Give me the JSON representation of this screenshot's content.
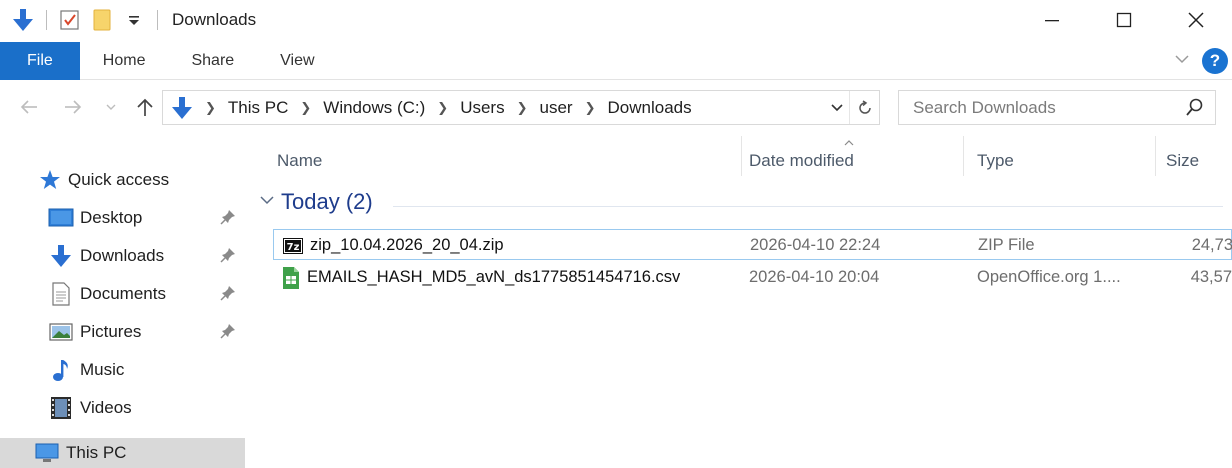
{
  "window": {
    "title": "Downloads"
  },
  "ribbon": {
    "tabs": [
      {
        "label": "File"
      },
      {
        "label": "Home"
      },
      {
        "label": "Share"
      },
      {
        "label": "View"
      }
    ],
    "help_label": "?"
  },
  "address": {
    "crumbs": [
      "This PC",
      "Windows (C:)",
      "Users",
      "user",
      "Downloads"
    ]
  },
  "search": {
    "placeholder": "Search Downloads"
  },
  "sidebar": {
    "quick_access": "Quick access",
    "items": [
      {
        "label": "Desktop",
        "icon": "desktop-icon",
        "pinned": true
      },
      {
        "label": "Downloads",
        "icon": "downloads-icon",
        "pinned": true
      },
      {
        "label": "Documents",
        "icon": "documents-icon",
        "pinned": true
      },
      {
        "label": "Pictures",
        "icon": "pictures-icon",
        "pinned": true
      },
      {
        "label": "Music",
        "icon": "music-icon",
        "pinned": false
      },
      {
        "label": "Videos",
        "icon": "videos-icon",
        "pinned": false
      }
    ],
    "this_pc": "This PC"
  },
  "filelist": {
    "columns": {
      "name": "Name",
      "date": "Date modified",
      "type": "Type",
      "size": "Size"
    },
    "group": {
      "title": "Today (2)"
    },
    "files": [
      {
        "name": "zip_10.04.2026_20_04.zip",
        "date": "2026-04-10 22:24",
        "type": "ZIP File",
        "size": "24,73",
        "icon": "7zip-icon"
      },
      {
        "name": "EMAILS_HASH_MD5_avN_ds1775851454716.csv",
        "date": "2026-04-10 20:04",
        "type": "OpenOffice.org 1....",
        "size": "43,57",
        "icon": "spreadsheet-icon"
      }
    ]
  },
  "colors": {
    "accent": "#1a6fc9",
    "group_title": "#1e3c8c",
    "selection_border": "#99c9ef"
  }
}
